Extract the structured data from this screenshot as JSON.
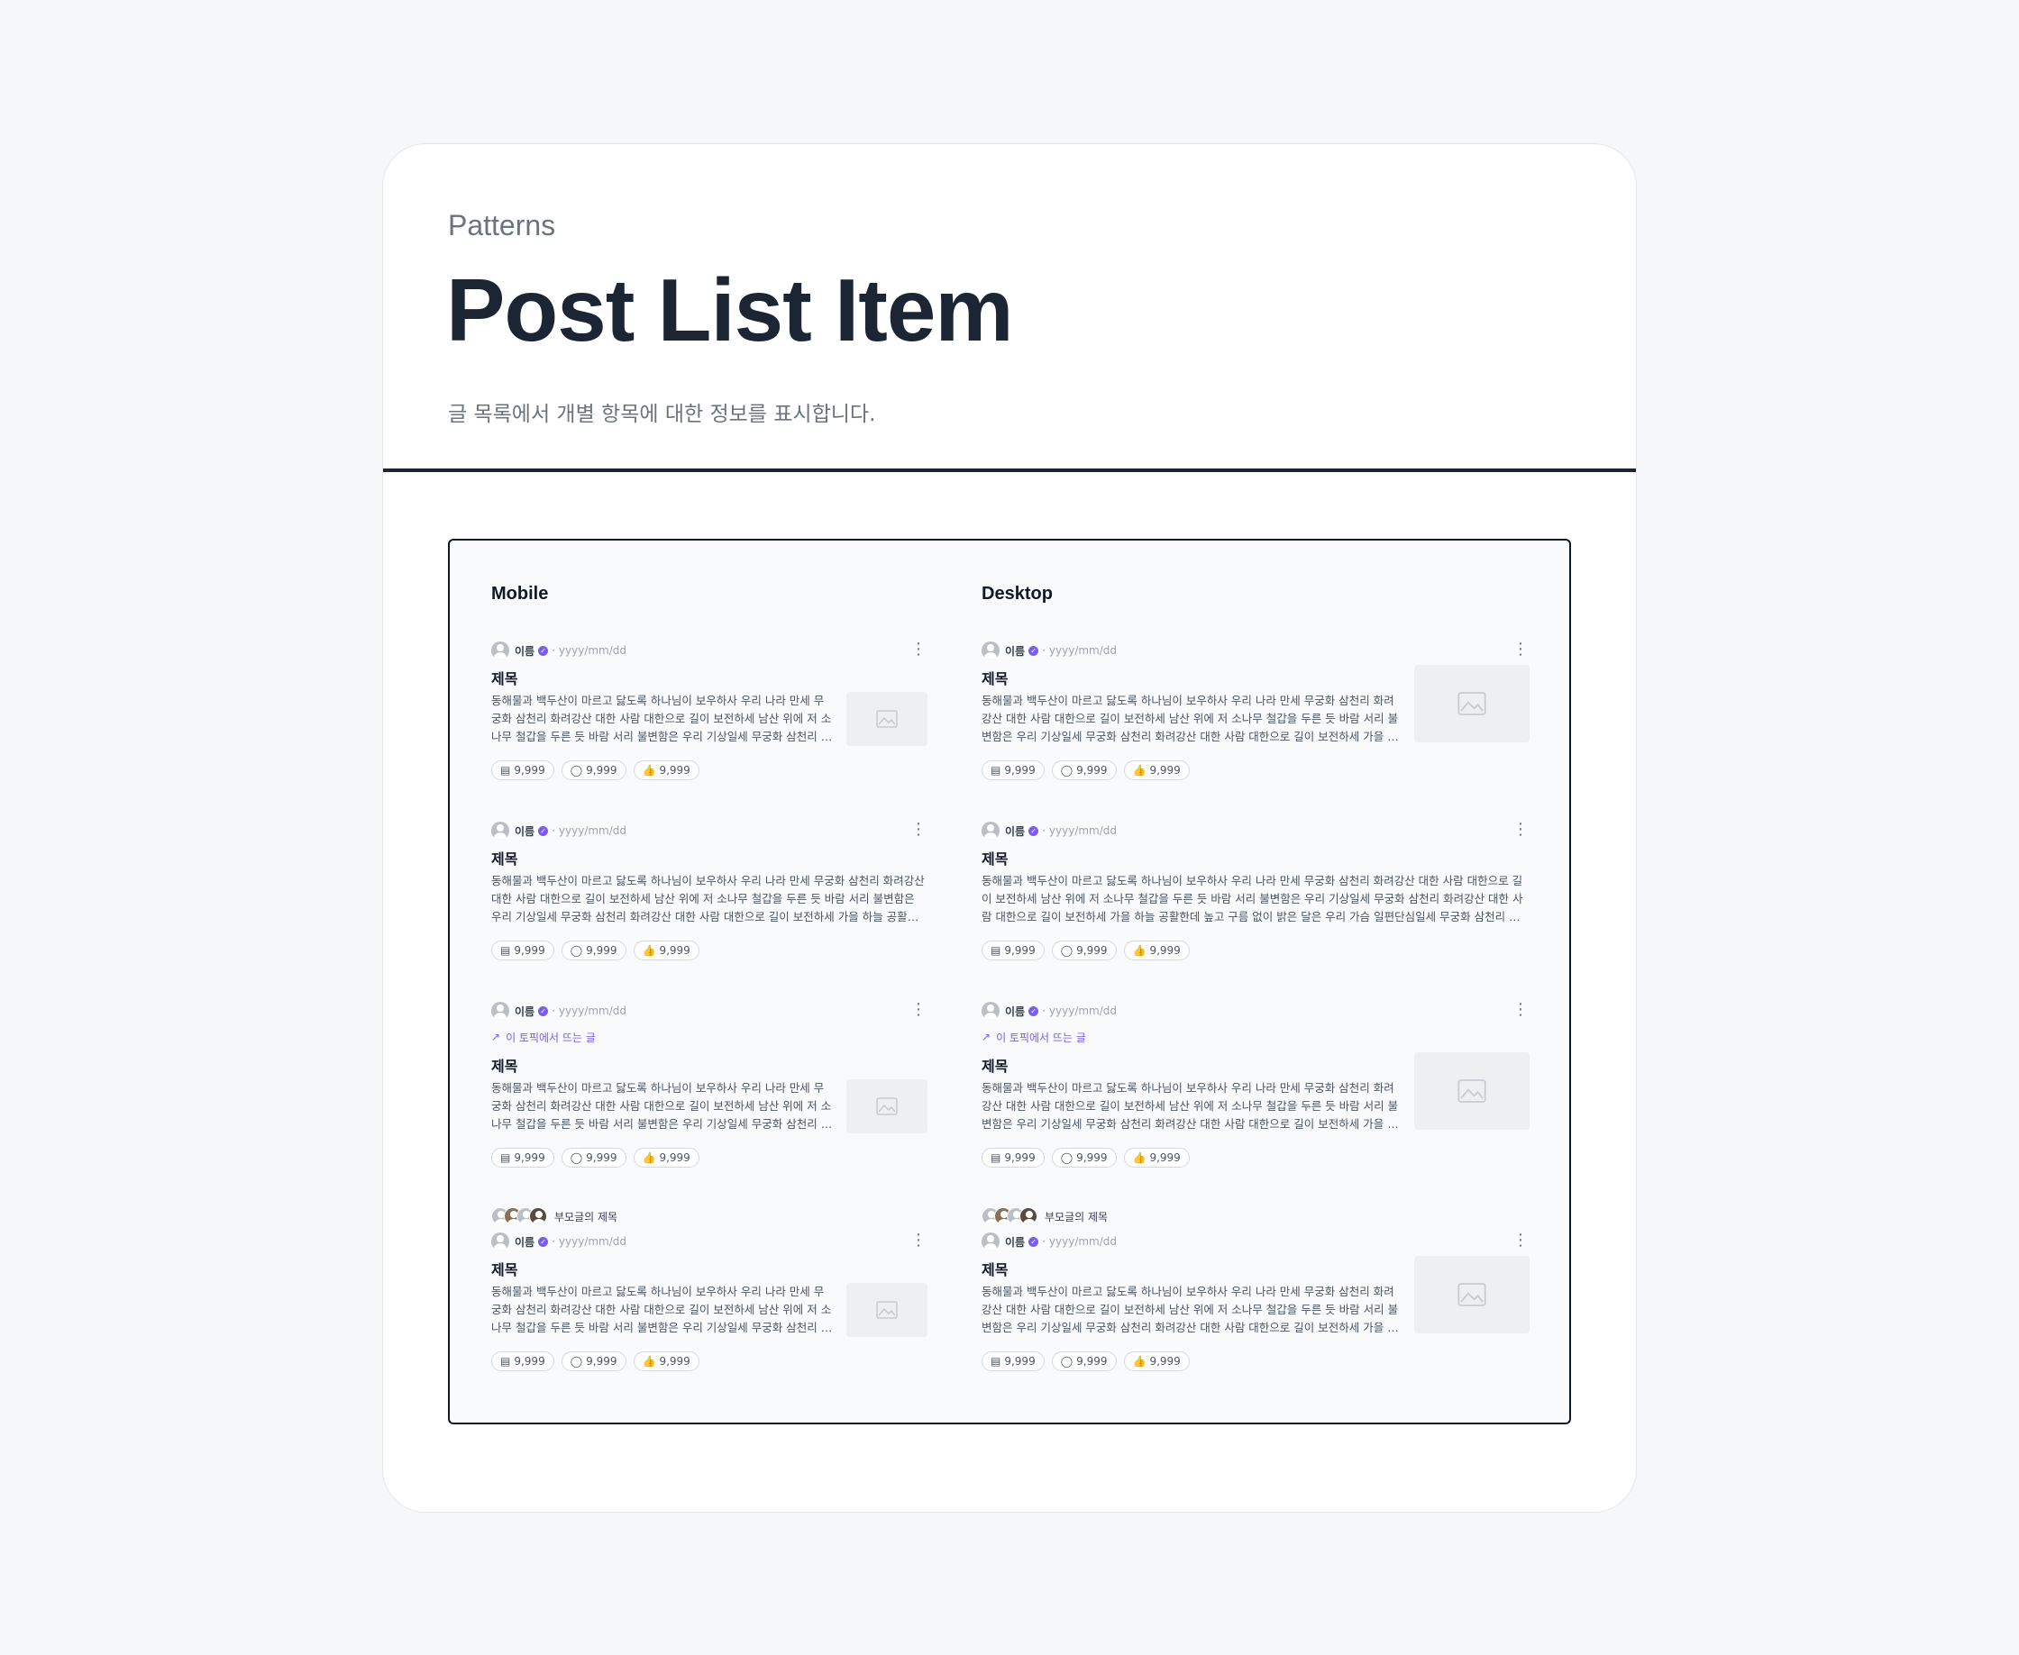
{
  "header": {
    "eyebrow": "Patterns",
    "title": "Post List Item",
    "subtitle": "글 목록에서 개별 항목에 대한 정보를 표시합니다."
  },
  "colors": {
    "accent": "#7c5cf0",
    "heading": "#1c2534"
  },
  "columns": {
    "mobile": "Mobile",
    "desktop": "Desktop"
  },
  "author": "이름",
  "date": "yyyy/mm/dd",
  "post_title": "제목",
  "trend_label": "이 토픽에서 뜨는 글",
  "parent_title": "부모글의 제목",
  "stats": {
    "views": "9,999",
    "comments": "9,999",
    "likes": "9,999"
  },
  "mobile_excerpt": "동해물과 백두산이 마르고 닳도록 하나님이 보우하사 우리 나라 만세 무궁화 삼천리 화려강산 대한 사람 대한으로 길이 보전하세 남산 위에 저 소나무 철갑을 두른 듯 바람 서리 불변함은 우리 기상일세 무궁화 삼천리 화려강산 대한 사람 대한으로 길이 보전하세 가을 하늘 공활한데",
  "desktop_excerpt": "동해물과 백두산이 마르고 닳도록 하나님이 보우하사 우리 나라 만세 무궁화 삼천리 화려강산 대한 사람 대한으로 길이 보전하세 남산 위에 저 소나무 철갑을 두른 듯 바람 서리 불변함은 우리 기상일세 무궁화 삼천리 화려강산 대한 사람 대한으로 길이 보전하세 가을 하늘 공활한데",
  "desktop_excerpt_long": "동해물과 백두산이 마르고 닳도록 하나님이 보우하사 우리 나라 만세 무궁화 삼천리 화려강산 대한 사람 대한으로 길이 보전하세 남산 위에 저 소나무 철갑을 두른 듯 바람 서리 불변함은 우리 기상일세 무궁화 삼천리 화려강산 대한 사람 대한으로 길이 보전하세 가을 하늘 공활한데 높고 구름 없이 밝은 달은 우리 가슴 일편단심일세 무궁화 삼천리 화려강산"
}
